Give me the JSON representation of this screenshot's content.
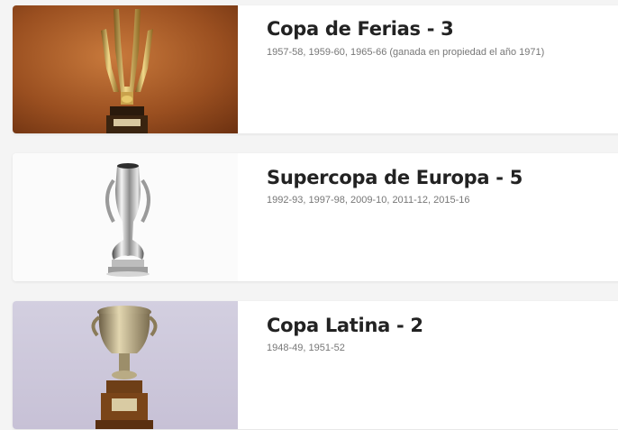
{
  "trophies": [
    {
      "title": "Copa de Ferias - 3",
      "years": "1957-58, 1959-60, 1965-66 (ganada en propiedad el año 1971)",
      "image_icon": "copa-de-ferias-trophy-icon"
    },
    {
      "title": "Supercopa de Europa - 5",
      "years": "1992-93, 1997-98, 2009-10, 2011-12, 2015-16",
      "image_icon": "supercopa-de-europa-trophy-icon"
    },
    {
      "title": "Copa Latina - 2",
      "years": "1948-49, 1951-52",
      "image_icon": "copa-latina-trophy-icon"
    }
  ]
}
